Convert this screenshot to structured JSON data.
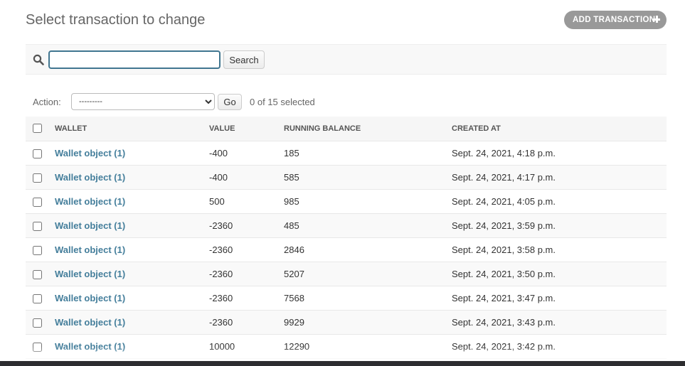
{
  "header": {
    "title": "Select transaction to change",
    "add_label": "ADD TRANSACTION"
  },
  "search": {
    "value": "",
    "placeholder": "",
    "button_label": "Search"
  },
  "actions": {
    "label": "Action:",
    "selected_option": "---------",
    "go_label": "Go",
    "selected_count": "0 of 15 selected"
  },
  "table": {
    "columns": [
      "WALLET",
      "VALUE",
      "RUNNING BALANCE",
      "CREATED AT"
    ],
    "rows": [
      {
        "wallet": "Wallet object (1)",
        "value": "-400",
        "running_balance": "185",
        "created_at": "Sept. 24, 2021, 4:18 p.m."
      },
      {
        "wallet": "Wallet object (1)",
        "value": "-400",
        "running_balance": "585",
        "created_at": "Sept. 24, 2021, 4:17 p.m."
      },
      {
        "wallet": "Wallet object (1)",
        "value": "500",
        "running_balance": "985",
        "created_at": "Sept. 24, 2021, 4:05 p.m."
      },
      {
        "wallet": "Wallet object (1)",
        "value": "-2360",
        "running_balance": "485",
        "created_at": "Sept. 24, 2021, 3:59 p.m."
      },
      {
        "wallet": "Wallet object (1)",
        "value": "-2360",
        "running_balance": "2846",
        "created_at": "Sept. 24, 2021, 3:58 p.m."
      },
      {
        "wallet": "Wallet object (1)",
        "value": "-2360",
        "running_balance": "5207",
        "created_at": "Sept. 24, 2021, 3:50 p.m."
      },
      {
        "wallet": "Wallet object (1)",
        "value": "-2360",
        "running_balance": "7568",
        "created_at": "Sept. 24, 2021, 3:47 p.m."
      },
      {
        "wallet": "Wallet object (1)",
        "value": "-2360",
        "running_balance": "9929",
        "created_at": "Sept. 24, 2021, 3:43 p.m."
      },
      {
        "wallet": "Wallet object (1)",
        "value": "10000",
        "running_balance": "12290",
        "created_at": "Sept. 24, 2021, 3:42 p.m."
      }
    ]
  },
  "colors": {
    "link": "#447e9b",
    "focus_border": "#417690",
    "add_button_bg": "#999999"
  },
  "icons": {
    "search": "search-icon",
    "add": "plus-icon"
  }
}
